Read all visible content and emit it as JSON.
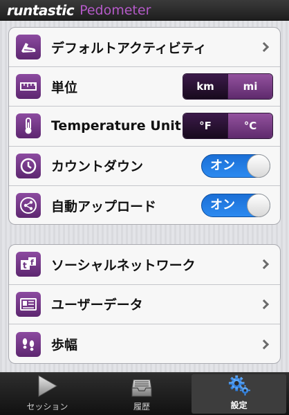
{
  "header": {
    "brand": "runtastic",
    "product": "Pedometer"
  },
  "settings_group1": [
    {
      "label": "デフォルトアクティビティ",
      "icon": "shoe-icon"
    },
    {
      "label": "単位",
      "icon": "ruler-icon",
      "options": [
        "km",
        "mi"
      ],
      "selected": "km"
    },
    {
      "label": "Temperature Unit",
      "icon": "thermometer-icon",
      "options": [
        "°F",
        "°C"
      ],
      "selected": "°F"
    },
    {
      "label": "カウントダウン",
      "icon": "clock-icon",
      "toggle": "オン"
    },
    {
      "label": "自動アップロード",
      "icon": "share-icon",
      "toggle": "オン"
    }
  ],
  "settings_group2": [
    {
      "label": "ソーシャルネットワーク",
      "icon": "social-icon"
    },
    {
      "label": "ユーザーデータ",
      "icon": "id-card-icon"
    },
    {
      "label": "歩幅",
      "icon": "footsteps-icon"
    }
  ],
  "tabs": [
    {
      "label": "セッション",
      "icon": "play-icon",
      "active": false
    },
    {
      "label": "履歴",
      "icon": "tray-icon",
      "active": false
    },
    {
      "label": "設定",
      "icon": "gear-icon",
      "active": true
    }
  ],
  "colors": {
    "accent": "#7a3b8f",
    "toggle": "#1f78e0",
    "brand_product": "#b45ac8"
  }
}
